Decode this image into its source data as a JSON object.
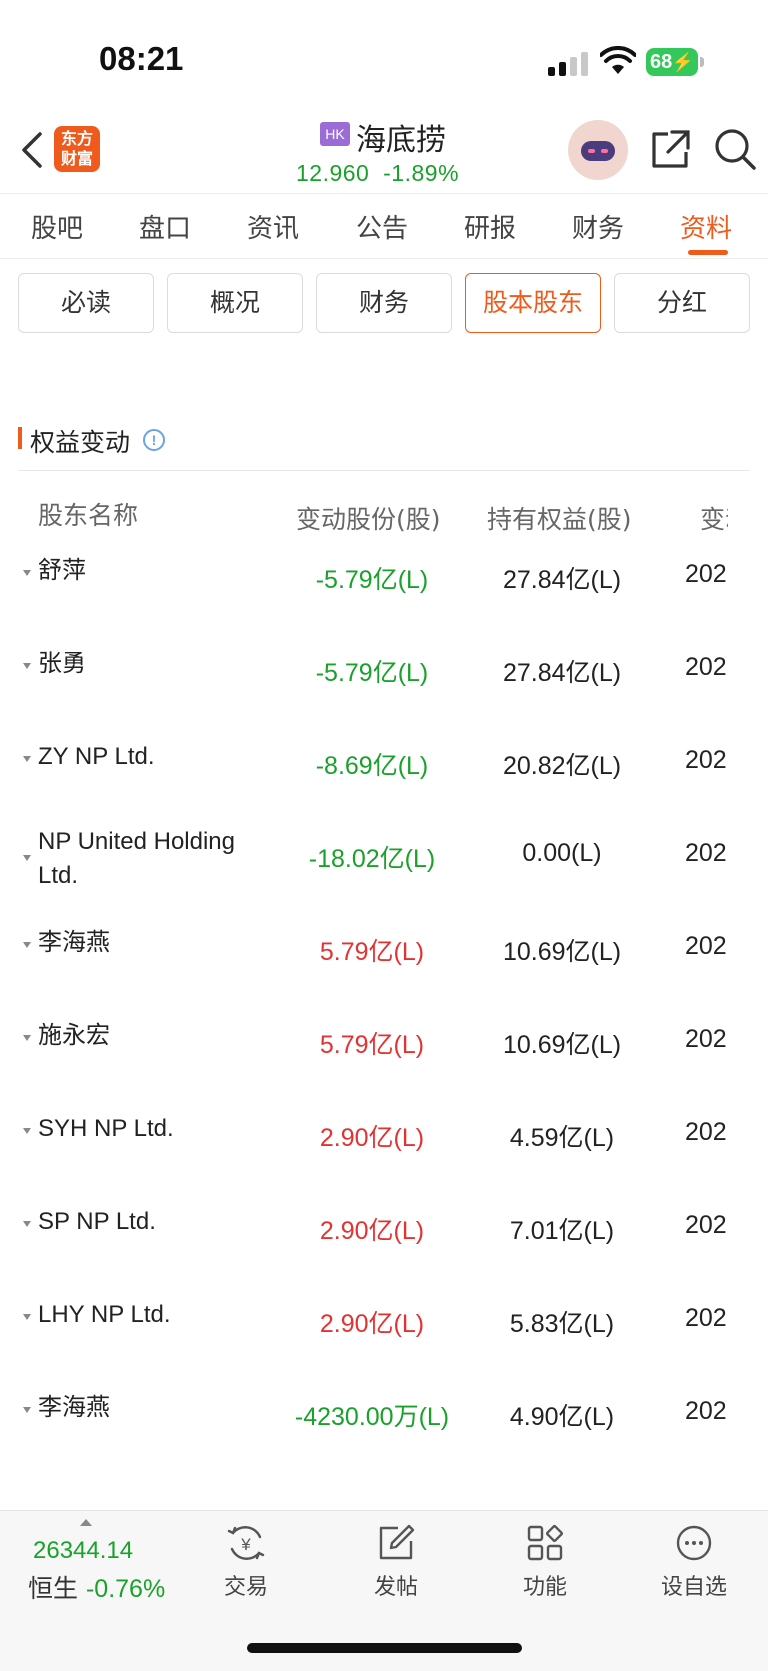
{
  "status_bar": {
    "time": "08:21",
    "battery": "68"
  },
  "header": {
    "logo_text": "东方财富",
    "market_badge": "HK",
    "stock_name": "海底捞",
    "price": "12.960",
    "change_pct": "-1.89%"
  },
  "tabs": [
    {
      "label": "股吧",
      "active": false
    },
    {
      "label": "盘口",
      "active": false
    },
    {
      "label": "资讯",
      "active": false
    },
    {
      "label": "公告",
      "active": false
    },
    {
      "label": "研报",
      "active": false
    },
    {
      "label": "财务",
      "active": false
    },
    {
      "label": "资料",
      "active": true
    }
  ],
  "sub_tabs": [
    {
      "label": "必读",
      "active": false
    },
    {
      "label": "概况",
      "active": false
    },
    {
      "label": "财务",
      "active": false
    },
    {
      "label": "股本股东",
      "active": true
    },
    {
      "label": "分红",
      "active": false
    }
  ],
  "section": {
    "title": "权益变动",
    "info_icon": "info-icon"
  },
  "table": {
    "headers": [
      "股东名称",
      "变动股份(股)",
      "持有权益(股)",
      "变动"
    ],
    "rows": [
      {
        "name": "舒萍",
        "change": "-5.79亿(L)",
        "direction": "down",
        "holding": "27.84亿(L)",
        "date": "202"
      },
      {
        "name": "张勇",
        "change": "-5.79亿(L)",
        "direction": "down",
        "holding": "27.84亿(L)",
        "date": "202"
      },
      {
        "name": "ZY NP Ltd.",
        "change": "-8.69亿(L)",
        "direction": "down",
        "holding": "20.82亿(L)",
        "date": "202"
      },
      {
        "name": "NP United Holding Ltd.",
        "change": "-18.02亿(L)",
        "direction": "down",
        "holding": "0.00(L)",
        "date": "202"
      },
      {
        "name": "李海燕",
        "change": "5.79亿(L)",
        "direction": "up",
        "holding": "10.69亿(L)",
        "date": "202"
      },
      {
        "name": "施永宏",
        "change": "5.79亿(L)",
        "direction": "up",
        "holding": "10.69亿(L)",
        "date": "202"
      },
      {
        "name": "SYH NP Ltd.",
        "change": "2.90亿(L)",
        "direction": "up",
        "holding": "4.59亿(L)",
        "date": "202"
      },
      {
        "name": "SP NP Ltd.",
        "change": "2.90亿(L)",
        "direction": "up",
        "holding": "7.01亿(L)",
        "date": "202"
      },
      {
        "name": "LHY NP Ltd.",
        "change": "2.90亿(L)",
        "direction": "up",
        "holding": "5.83亿(L)",
        "date": "202"
      },
      {
        "name": "李海燕",
        "change": "-4230.00万(L)",
        "direction": "down",
        "holding": "4.90亿(L)",
        "date": "202"
      }
    ]
  },
  "bottom_bar": {
    "index_value": "26344.14",
    "index_name": "恒生",
    "index_change": "-0.76%",
    "items": [
      {
        "label": "交易",
        "icon": "trade-yen-icon"
      },
      {
        "label": "发帖",
        "icon": "compose-icon"
      },
      {
        "label": "功能",
        "icon": "grid-icon"
      },
      {
        "label": "设自选",
        "icon": "more-dots-icon"
      }
    ]
  },
  "colors": {
    "accent": "#ef5a1d",
    "up": "#e23232",
    "down": "#1aa12b",
    "hk_badge": "#9b6cd6"
  }
}
